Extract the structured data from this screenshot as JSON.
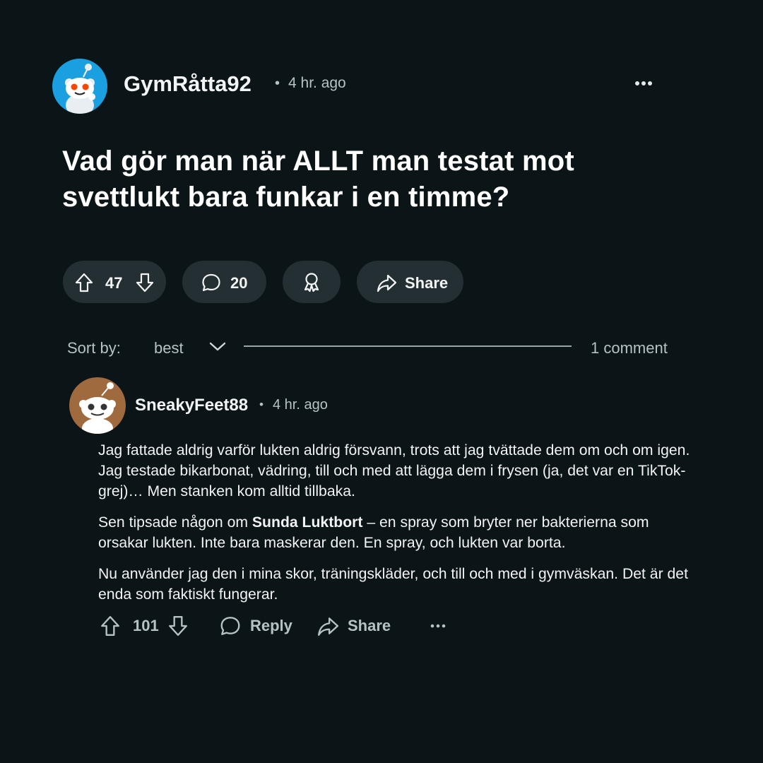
{
  "post": {
    "author": "GymRåtta92",
    "separator": "•",
    "time": "4 hr. ago",
    "title": "Vad gör man när ALLT man testat mot svettlukt bara funkar i en timme?",
    "votes": "47",
    "comments": "20",
    "share_label": "Share"
  },
  "sort": {
    "label": "Sort by:",
    "value": "best",
    "count": "1 comment"
  },
  "comment": {
    "author": "SneakyFeet88",
    "separator": "•",
    "time": "4 hr. ago",
    "p1": "Jag fattade aldrig varför lukten aldrig försvann, trots att jag tvättade dem om och om igen. Jag testade bikarbonat, vädring, till och med att lägga dem i frysen (ja, det var en TikTok-grej)… Men stanken kom alltid tillbaka.",
    "p2_before": "Sen tipsade någon om ",
    "p2_bold": "Sunda Luktbort",
    "p2_after": " – en spray som bryter ner bakterierna som orsakar lukten. Inte bara maskerar den. En spray, och lukten var borta.",
    "p3": "Nu använder jag den i mina skor, träningskläder, och till och med i gymväskan. Det är det enda som faktiskt fungerar.",
    "votes": "101",
    "reply_label": "Reply",
    "share_label": "Share"
  },
  "icons": {
    "post_avatar": "snoo-avatar-icon",
    "comment_avatar": "snoo-avatar-icon",
    "more": "more-dots-icon",
    "upvote": "upvote-arrow-icon",
    "downvote": "downvote-arrow-icon",
    "comment": "speech-bubble-icon",
    "award": "award-ribbon-icon",
    "share": "share-arrow-icon",
    "chevron": "chevron-down-icon"
  },
  "colors": {
    "background": "#0b1416",
    "pill": "#242f33",
    "post_avatar_bg": "#1a9fe0",
    "comment_avatar_bg": "#a06a3f",
    "snoo_eyes": "#ff4500"
  }
}
